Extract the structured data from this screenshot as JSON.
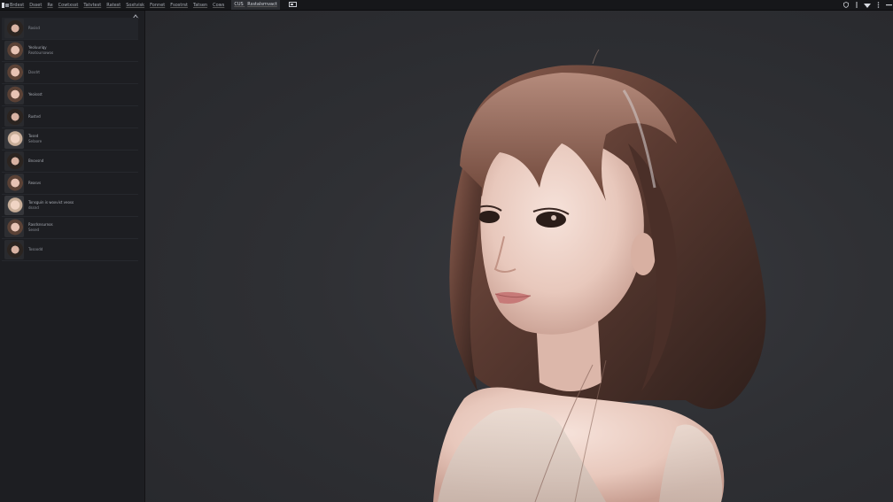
{
  "menubar": {
    "logo_icon": "app-logo-icon",
    "items": [
      {
        "label": "Brdest"
      },
      {
        "label": "Dsset"
      },
      {
        "label": "Re"
      },
      {
        "label": "Cowtxsst"
      },
      {
        "label": "Tatvtest"
      },
      {
        "label": "Ratest"
      },
      {
        "label": "Soxtvisk"
      },
      {
        "label": "Fonnet"
      },
      {
        "label": "Fsostrst"
      },
      {
        "label": "Tatsen"
      },
      {
        "label": "Cows"
      }
    ],
    "active_tab": {
      "label": "Rsstalsrnvact",
      "prefix": "CUS"
    },
    "display_icon": "display-icon",
    "window_controls": [
      "shield-icon",
      "divider-icon",
      "wifi-icon",
      "more-icon",
      "minimize-icon"
    ]
  },
  "sidebar": {
    "expand_icon": "expand-icon",
    "items": [
      {
        "line1": "",
        "line2": "Rosisd"
      },
      {
        "line1": "Yeoluuriqy",
        "line2": "Reatoursowoo"
      },
      {
        "line1": "",
        "line2": "Dssdrt"
      },
      {
        "line1": "Yeoissst",
        "line2": ""
      },
      {
        "line1": "Rustvd",
        "line2": ""
      },
      {
        "line1": "Tosed",
        "line2": "Selaore"
      },
      {
        "line1": "Bnovsnd",
        "line2": ""
      },
      {
        "line1": "Reasvs",
        "line2": ""
      },
      {
        "line1": "Tonsguin is woxvist veoso",
        "line2": "dssnd"
      },
      {
        "line1": "Rasdsnsurnos",
        "line2": "Sesed"
      },
      {
        "line1": "",
        "line2": "Tosoodd"
      }
    ]
  },
  "canvas": {
    "background_color": "#2f3034",
    "subject": "portrait-render"
  },
  "colors": {
    "menubar_bg": "#16171a",
    "sidebar_bg": "#1d1e22",
    "canvas_bg": "#2f3034"
  }
}
